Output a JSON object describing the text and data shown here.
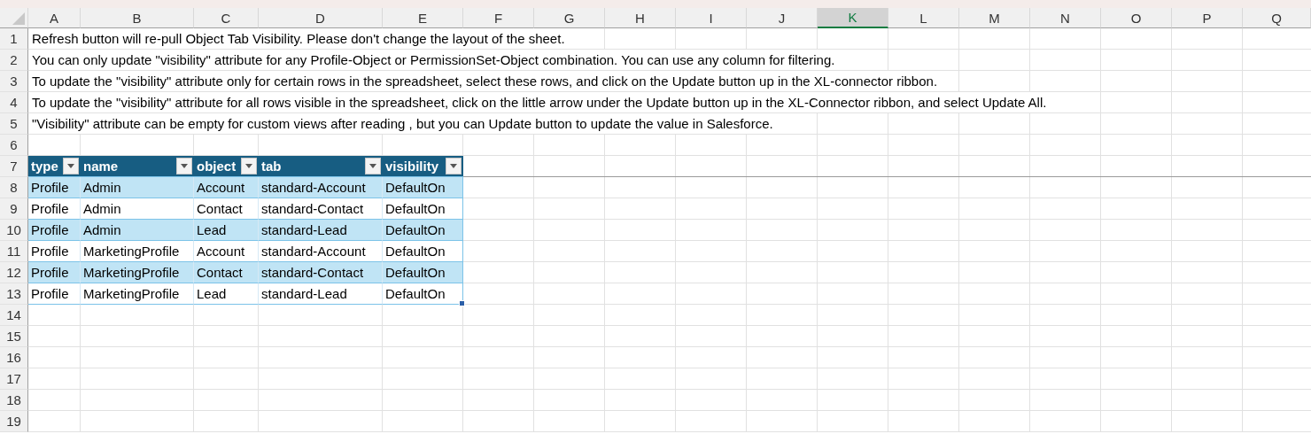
{
  "columns": [
    {
      "label": "A",
      "selected": false
    },
    {
      "label": "B",
      "selected": false
    },
    {
      "label": "C",
      "selected": false
    },
    {
      "label": "D",
      "selected": false
    },
    {
      "label": "E",
      "selected": false
    },
    {
      "label": "F",
      "selected": false
    },
    {
      "label": "G",
      "selected": false
    },
    {
      "label": "H",
      "selected": false
    },
    {
      "label": "I",
      "selected": false
    },
    {
      "label": "J",
      "selected": false
    },
    {
      "label": "K",
      "selected": true
    },
    {
      "label": "L",
      "selected": false
    },
    {
      "label": "M",
      "selected": false
    },
    {
      "label": "N",
      "selected": false
    },
    {
      "label": "O",
      "selected": false
    },
    {
      "label": "P",
      "selected": false
    },
    {
      "label": "Q",
      "selected": false
    }
  ],
  "rows": [
    {
      "number": "1",
      "kind": "note",
      "text": "Refresh button will re-pull Object Tab Visibility. Please don't change the layout of the sheet."
    },
    {
      "number": "2",
      "kind": "note",
      "text": "You can only update \"visibility\" attribute for any Profile-Object or PermissionSet-Object combination. You can use any column for filtering."
    },
    {
      "number": "3",
      "kind": "note",
      "text": "To update the \"visibility\" attribute only for certain rows in the spreadsheet, select these rows, and click on the Update button up in the XL-connector ribbon."
    },
    {
      "number": "4",
      "kind": "note",
      "text": "To update the \"visibility\" attribute for all rows visible in the spreadsheet, click on the little arrow under the Update button up in the XL-Connector ribbon, and select Update All."
    },
    {
      "number": "5",
      "kind": "note",
      "text": "\"Visibility\" attribute can be empty for custom views after reading , but you can Update button to update the value in Salesforce."
    },
    {
      "number": "6",
      "kind": "empty"
    },
    {
      "number": "7",
      "kind": "table_header",
      "cells": [
        "type",
        "name",
        "object",
        "tab",
        "visibility"
      ]
    },
    {
      "number": "8",
      "kind": "table_row",
      "banded": true,
      "cells": [
        "Profile",
        "Admin",
        "Account",
        "standard-Account",
        "DefaultOn"
      ]
    },
    {
      "number": "9",
      "kind": "table_row",
      "banded": false,
      "cells": [
        "Profile",
        "Admin",
        "Contact",
        "standard-Contact",
        "DefaultOn"
      ]
    },
    {
      "number": "10",
      "kind": "table_row",
      "banded": true,
      "cells": [
        "Profile",
        "Admin",
        "Lead",
        "standard-Lead",
        "DefaultOn"
      ]
    },
    {
      "number": "11",
      "kind": "table_row",
      "banded": false,
      "cells": [
        "Profile",
        "MarketingProfile",
        "Account",
        "standard-Account",
        "DefaultOn"
      ]
    },
    {
      "number": "12",
      "kind": "table_row",
      "banded": true,
      "cells": [
        "Profile",
        "MarketingProfile",
        "Contact",
        "standard-Contact",
        "DefaultOn"
      ]
    },
    {
      "number": "13",
      "kind": "table_row",
      "banded": false,
      "cells": [
        "Profile",
        "MarketingProfile",
        "Lead",
        "standard-Lead",
        "DefaultOn"
      ]
    },
    {
      "number": "14",
      "kind": "empty"
    },
    {
      "number": "15",
      "kind": "empty"
    },
    {
      "number": "16",
      "kind": "empty"
    },
    {
      "number": "17",
      "kind": "empty"
    },
    {
      "number": "18",
      "kind": "empty"
    },
    {
      "number": "19",
      "kind": "empty"
    }
  ]
}
